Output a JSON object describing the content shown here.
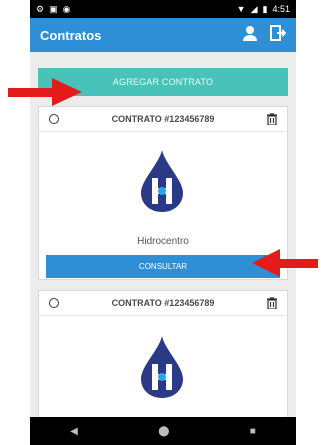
{
  "status": {
    "time": "4:51",
    "left_icons": [
      "gear-icon",
      "notification-icon",
      "circle-icon"
    ],
    "right_icons": [
      "wifi-icon",
      "signal-icon",
      "battery-icon"
    ]
  },
  "header": {
    "title": "Contratos"
  },
  "actions": {
    "add_contract": "AGREGAR CONTRATO"
  },
  "cards": [
    {
      "title": "CONTRATO #123456789",
      "brand": "Hidrocentro",
      "button": "CONSULTAR"
    },
    {
      "title": "CONTRATO #123456789"
    }
  ],
  "nav": {
    "back": "◀",
    "home": "⬤",
    "recent": "■"
  },
  "colors": {
    "primary": "#2e8fd6",
    "accent": "#49c3ba",
    "arrow": "#e31b1b"
  }
}
